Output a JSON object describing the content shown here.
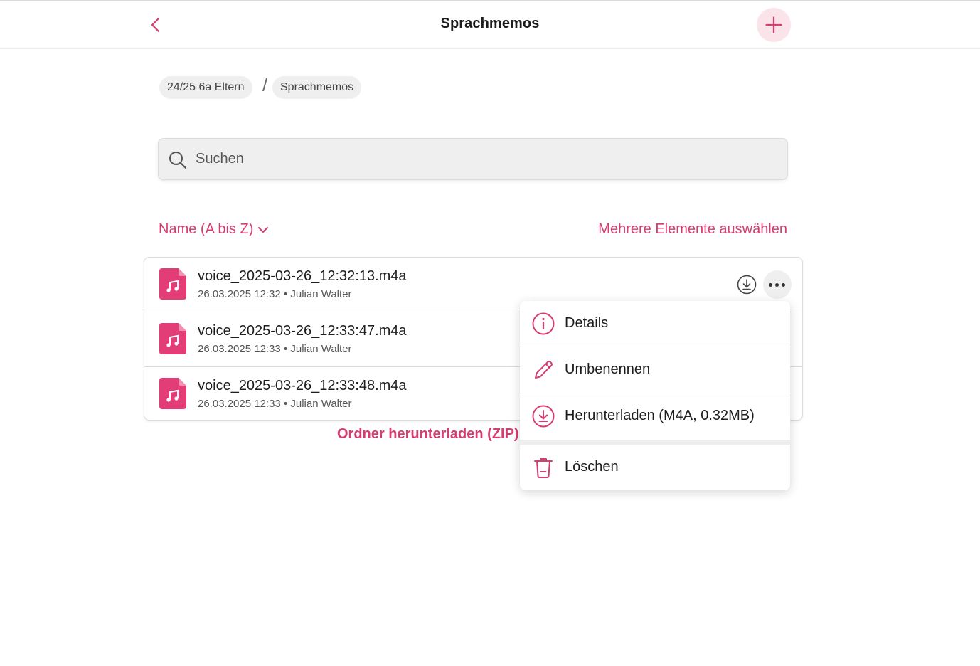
{
  "header": {
    "title": "Sprachmemos",
    "back_icon": "chevron-left-icon",
    "add_icon": "plus-icon"
  },
  "breadcrumb": {
    "items": [
      "24/25 6a Eltern",
      "Sprachmemos"
    ],
    "separator": "/"
  },
  "search": {
    "placeholder": "Suchen",
    "value": ""
  },
  "toolbar": {
    "sort_label": "Name (A bis Z)",
    "select_multiple_label": "Mehrere Elemente auswählen"
  },
  "files": [
    {
      "name": "voice_2025-03-26_12:32:13.m4a",
      "meta": "26.03.2025 12:32 • Julian Walter"
    },
    {
      "name": "voice_2025-03-26_12:33:47.m4a",
      "meta": "26.03.2025 12:33 • Julian Walter"
    },
    {
      "name": "voice_2025-03-26_12:33:48.m4a",
      "meta": "26.03.2025 12:33 • Julian Walter"
    }
  ],
  "download_folder_label": "Ordner herunterladen (ZIP)",
  "context_menu": {
    "items": [
      {
        "label": "Details",
        "icon": "info-icon"
      },
      {
        "label": "Umbenennen",
        "icon": "pencil-icon"
      },
      {
        "label": "Herunterladen (M4A, 0.32MB)",
        "icon": "download-icon"
      },
      {
        "label": "Löschen",
        "icon": "trash-icon"
      }
    ]
  },
  "colors": {
    "accent": "#d63b72",
    "accent_light": "#fbe3ea",
    "file_icon": "#e33d78"
  }
}
